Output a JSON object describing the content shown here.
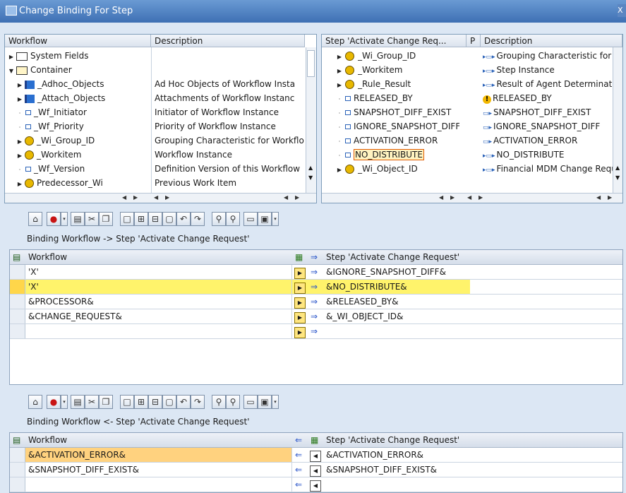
{
  "window": {
    "title": "Change Binding For Step",
    "close_label": "X"
  },
  "left_tree": {
    "columns": [
      "Workflow",
      "Description"
    ],
    "rows": [
      {
        "name": "System Fields",
        "desc": ""
      },
      {
        "name": "Container",
        "desc": ""
      },
      {
        "name": "_Adhoc_Objects",
        "desc": "Ad Hoc Objects of Workflow Insta"
      },
      {
        "name": "_Attach_Objects",
        "desc": "Attachments of Workflow Instanc"
      },
      {
        "name": "_Wf_Initiator",
        "desc": "Initiator of Workflow Instance"
      },
      {
        "name": "_Wf_Priority",
        "desc": "Priority of Workflow Instance"
      },
      {
        "name": "_Wi_Group_ID",
        "desc": "Grouping Characteristic for Workflo"
      },
      {
        "name": "_Workitem",
        "desc": "Workflow Instance"
      },
      {
        "name": "_Wf_Version",
        "desc": "Definition Version of this Workflow"
      },
      {
        "name": "Predecessor_Wi",
        "desc": "Previous Work Item"
      }
    ]
  },
  "right_tree": {
    "columns": [
      "Step 'Activate Change Req...",
      "P",
      "Description"
    ],
    "rows": [
      {
        "name": "_Wi_Group_ID",
        "desc": "Grouping Characteristic for Wo"
      },
      {
        "name": "_Workitem",
        "desc": "Step Instance"
      },
      {
        "name": "_Rule_Result",
        "desc": "Result of Agent Determination"
      },
      {
        "name": "RELEASED_BY",
        "desc": "RELEASED_BY"
      },
      {
        "name": "SNAPSHOT_DIFF_EXIST",
        "desc": "SNAPSHOT_DIFF_EXIST"
      },
      {
        "name": "IGNORE_SNAPSHOT_DIFF",
        "desc": "IGNORE_SNAPSHOT_DIFF"
      },
      {
        "name": "ACTIVATION_ERROR",
        "desc": "ACTIVATION_ERROR"
      },
      {
        "name": "NO_DISTRIBUTE",
        "desc": "NO_DISTRIBUTE"
      },
      {
        "name": "_Wi_Object_ID",
        "desc": "Financial MDM Change Request"
      }
    ]
  },
  "binding_in": {
    "caption": "Binding Workflow  -> Step 'Activate Change Request'",
    "col_left": "Workflow",
    "col_right": "Step 'Activate Change Request'",
    "rows": [
      {
        "left": "'X'",
        "right": "&IGNORE_SNAPSHOT_DIFF&"
      },
      {
        "left": "'X'",
        "right": "&NO_DISTRIBUTE&"
      },
      {
        "left": "&PROCESSOR&",
        "right": "&RELEASED_BY&"
      },
      {
        "left": "&CHANGE_REQUEST&",
        "right": "&_WI_OBJECT_ID&"
      },
      {
        "left": "",
        "right": ""
      }
    ]
  },
  "binding_out": {
    "caption": "Binding Workflow  <- Step 'Activate Change Request'",
    "col_left": "Workflow",
    "col_right": "Step 'Activate Change Request'",
    "rows": [
      {
        "left": "&ACTIVATION_ERROR&",
        "right": "&ACTIVATION_ERROR&"
      },
      {
        "left": "&SNAPSHOT_DIFF_EXIST&",
        "right": "&SNAPSHOT_DIFF_EXIST&"
      },
      {
        "left": "",
        "right": ""
      }
    ]
  },
  "colors": {
    "selection": "#ffe27a",
    "highlight_yellow": "#fff36b",
    "orange_row": "#ffd27f",
    "arrow": "#2450c8",
    "window_bg": "#dce7f4"
  }
}
